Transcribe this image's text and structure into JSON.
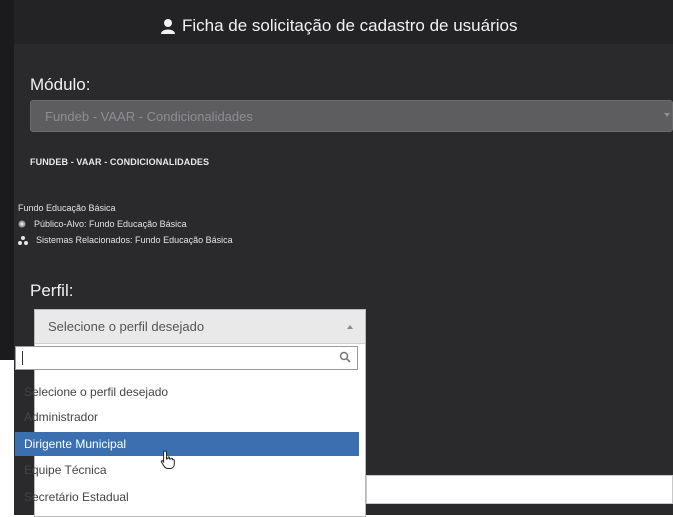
{
  "header": {
    "title": "Ficha de solicitação de cadastro de usuários",
    "icon": "user-icon"
  },
  "modulo": {
    "label": "Módulo:",
    "selected": "Fundeb - VAAR - Condicionalidades"
  },
  "module_info": {
    "heading": "FUNDEB - VAAR - CONDICIONALIDADES",
    "line1": "Fundo Educação Básica",
    "line2": "Público-Alvo: Fundo Educação Básica",
    "line3": "Sistemas Relacionados: Fundo Educação Básica"
  },
  "perfil": {
    "label": "Perfil:",
    "selected": "Selecione o perfil desejado",
    "search_value": "",
    "options": [
      "Selecione o perfil desejado",
      "Administrador",
      "Dirigente Municipal",
      "Equipe Técnica",
      "Secretário Estadual"
    ],
    "highlighted": "Dirigente Municipal"
  },
  "colors": {
    "background": "#2a2a2c",
    "highlight": "#3a6fb0"
  }
}
